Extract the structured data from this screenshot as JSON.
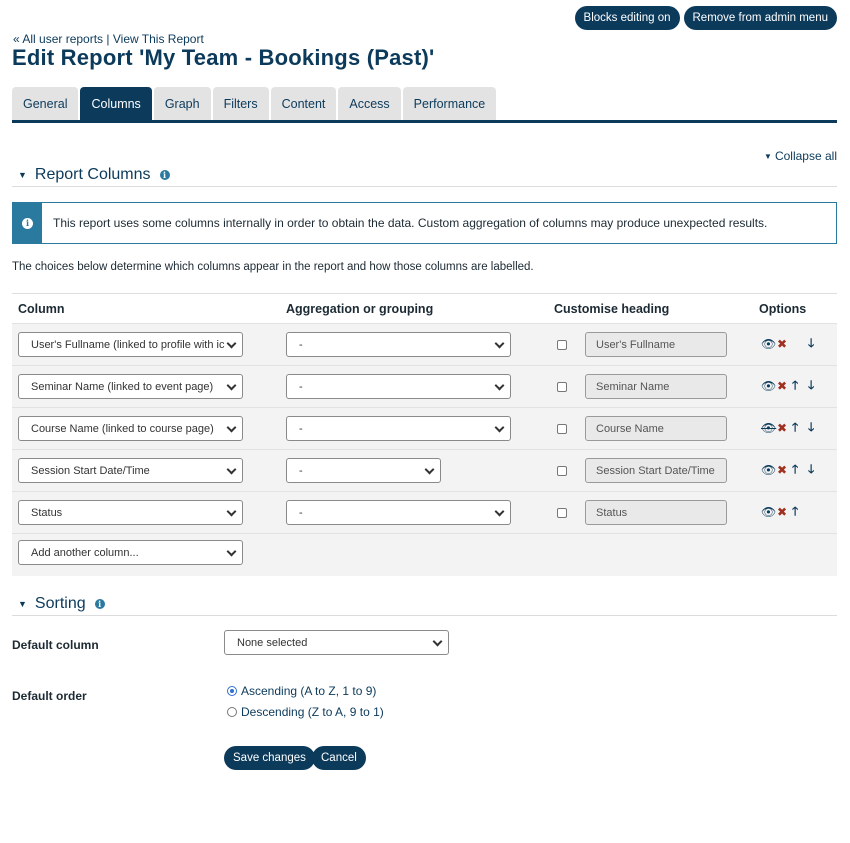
{
  "header_actions": {
    "blocks_editing": "Blocks editing on",
    "remove_admin_menu": "Remove from admin menu"
  },
  "breadcrumb": {
    "all_reports": "« All user reports",
    "separator": "|",
    "view_report": "View This Report"
  },
  "page_title": "Edit Report 'My Team - Bookings (Past)'",
  "tabs": [
    {
      "label": "General",
      "active": false
    },
    {
      "label": "Columns",
      "active": true
    },
    {
      "label": "Graph",
      "active": false
    },
    {
      "label": "Filters",
      "active": false
    },
    {
      "label": "Content",
      "active": false
    },
    {
      "label": "Access",
      "active": false
    },
    {
      "label": "Performance",
      "active": false
    }
  ],
  "collapse_all": "Collapse all",
  "report_columns": {
    "title": "Report Columns",
    "alert": "This report uses some columns internally in order to obtain the data. Custom aggregation of columns may produce unexpected results.",
    "intro": "The choices below determine which columns appear in the report and how those columns are labelled.",
    "headers": {
      "column": "Column",
      "aggregation": "Aggregation or grouping",
      "heading": "Customise heading",
      "options": "Options"
    },
    "rows": [
      {
        "column": "User's Fullname (linked to profile with ic",
        "aggregation": "-",
        "heading": "User's Fullname",
        "hidden": false,
        "move_up": false,
        "move_down": true
      },
      {
        "column": "Seminar Name (linked to event page)",
        "aggregation": "-",
        "heading": "Seminar Name",
        "hidden": false,
        "move_up": true,
        "move_down": true
      },
      {
        "column": "Course Name (linked to course page)",
        "aggregation": "-",
        "heading": "Course Name",
        "hidden": true,
        "move_up": true,
        "move_down": true
      },
      {
        "column": "Session Start Date/Time",
        "aggregation": "-",
        "heading": "Session Start Date/Time",
        "hidden": false,
        "move_up": true,
        "move_down": true
      },
      {
        "column": "Status",
        "aggregation": "-",
        "heading": "Status",
        "hidden": false,
        "move_up": true,
        "move_down": false
      }
    ],
    "add_column": "Add another column..."
  },
  "sorting": {
    "title": "Sorting",
    "default_column_label": "Default column",
    "default_column_value": "None selected",
    "default_order_label": "Default order",
    "order_options": [
      "Ascending (A to Z, 1 to 9)",
      "Descending (Z to A, 9 to 1)"
    ],
    "selected_order": 0
  },
  "buttons": {
    "save": "Save changes",
    "cancel": "Cancel"
  },
  "colors": {
    "brand": "#0c3a5b",
    "info": "#2a7a9f",
    "delete": "#a0301f"
  }
}
